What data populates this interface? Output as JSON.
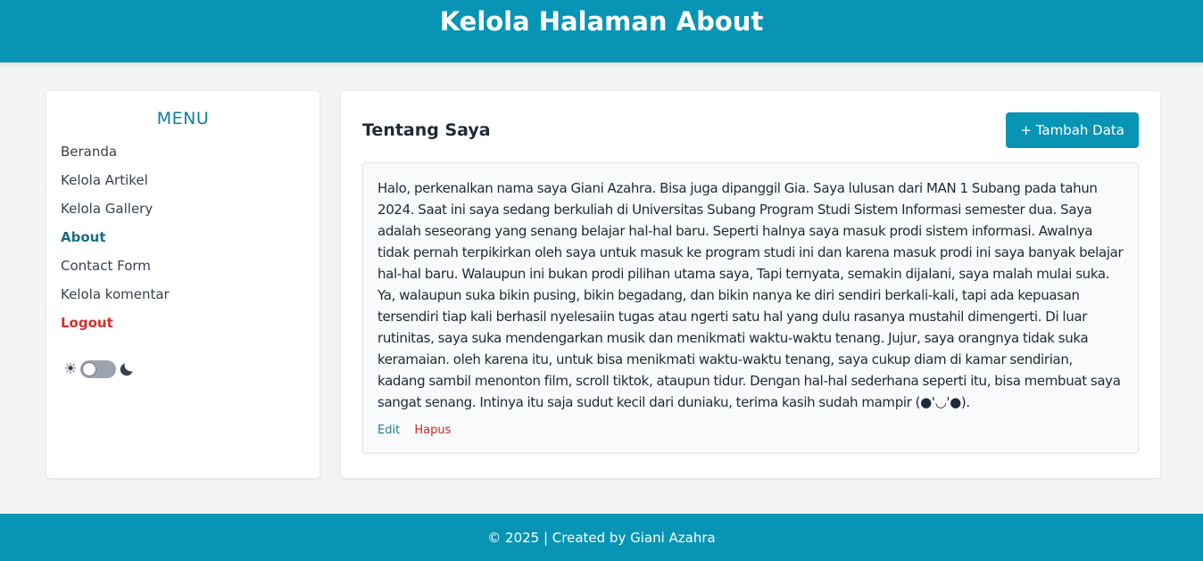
{
  "header": {
    "title": "Kelola Halaman About"
  },
  "sidebar": {
    "title": "MENU",
    "items": [
      {
        "label": "Beranda"
      },
      {
        "label": "Kelola Artikel"
      },
      {
        "label": "Kelola Gallery"
      },
      {
        "label": "About"
      },
      {
        "label": "Contact Form"
      },
      {
        "label": "Kelola komentar"
      },
      {
        "label": "Logout"
      }
    ],
    "theme_toggle": {
      "sun_icon": "☀",
      "moon_icon": "moon-icon",
      "state": "light"
    }
  },
  "main": {
    "title": "Tentang Saya",
    "add_button_label": "+ Tambah Data",
    "about_text": "Halo, perkenalkan nama saya Giani Azahra. Bisa juga dipanggil Gia. Saya lulusan dari MAN 1 Subang pada tahun 2024. Saat ini saya sedang berkuliah di Universitas Subang Program Studi Sistem Informasi semester dua. Saya adalah seseorang yang senang belajar hal-hal baru. Seperti halnya saya masuk prodi sistem informasi. Awalnya tidak pernah terpikirkan oleh saya untuk masuk ke program studi ini dan karena masuk prodi ini saya banyak belajar hal-hal baru. Walaupun ini bukan prodi pilihan utama saya, Tapi ternyata, semakin dijalani, saya malah mulai suka. Ya, walaupun suka bikin pusing, bikin begadang, dan bikin nanya ke diri sendiri berkali-kali, tapi ada kepuasan tersendiri tiap kali berhasil nyelesaiin tugas atau ngerti satu hal yang dulu rasanya mustahil dimengerti. Di luar rutinitas, saya suka mendengarkan musik dan menikmati waktu-waktu tenang. Jujur, saya orangnya tidak suka keramaian. oleh karena itu, untuk bisa menikmati waktu-waktu tenang, saya cukup diam di kamar sendirian, kadang sambil menonton film, scroll tiktok, ataupun tidur. Dengan hal-hal sederhana seperti itu, bisa membuat saya sangat senang. Intinya itu saja sudut kecil dari duniaku, terima kasih sudah mampir (●'◡'●).",
    "edit_label": "Edit",
    "delete_label": "Hapus"
  },
  "footer": {
    "text": "© 2025 | Created by Giani Azahra"
  },
  "colors": {
    "primary": "#0894b5",
    "menu_title": "#0e7fa2",
    "active_item": "#1b6f87",
    "logout": "#d32f2f",
    "delete": "#c62828",
    "page_bg": "#f3f4f6"
  }
}
